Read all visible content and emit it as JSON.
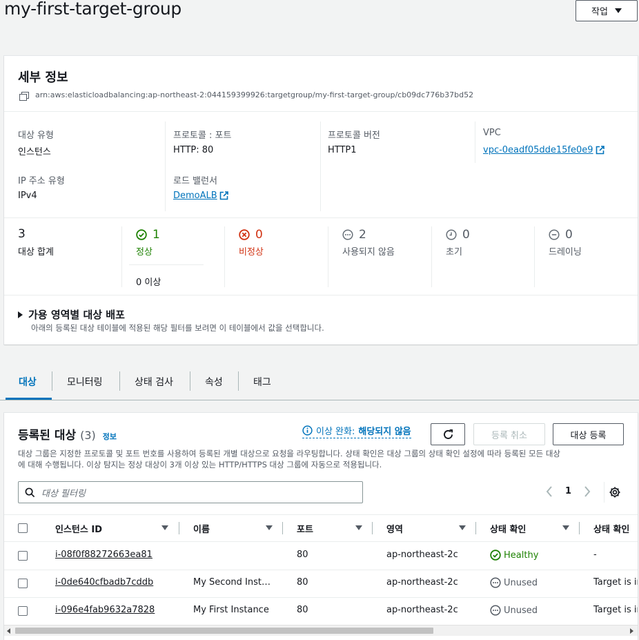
{
  "header": {
    "title": "my-first-target-group",
    "actions_label": "작업"
  },
  "details": {
    "heading": "세부 정보",
    "arn": "arn:aws:elasticloadbalancing:ap-northeast-2:044159399926:targetgroup/my-first-target-group/cb09dc776b37bd52",
    "target_type_label": "대상 유형",
    "target_type_value": "인스턴스",
    "protocol_port_label": "프로토콜 : 포트",
    "protocol_port_value": "HTTP: 80",
    "protocol_version_label": "프로토콜 버전",
    "protocol_version_value": "HTTP1",
    "vpc_label": "VPC",
    "vpc_value": "vpc-0eadf05dde15fe0e9",
    "ip_type_label": "IP 주소 유형",
    "ip_type_value": "IPv4",
    "lb_label": "로드 밸런서",
    "lb_value": "DemoALB"
  },
  "stats": {
    "total_value": "3",
    "total_label": "대상 합계",
    "healthy_value": "1",
    "healthy_label": "정상",
    "healthy_sub": "0 이상",
    "unhealthy_value": "0",
    "unhealthy_label": "비정상",
    "unused_value": "2",
    "unused_label": "사용되지 않음",
    "initial_value": "0",
    "initial_label": "초기",
    "draining_value": "0",
    "draining_label": "드레이닝"
  },
  "az": {
    "title": "가용 영역별 대상 배포",
    "desc": "아래의 등록된 대상 테이블에 적용된 해당 필터를 보려면 이 테이블에서 값을 선택합니다."
  },
  "tabs": [
    "대상",
    "모니터링",
    "상태 검사",
    "속성",
    "태그"
  ],
  "targets": {
    "title": "등록된 대상",
    "count": "(3)",
    "info": "정보",
    "anomaly_label": "이상 완화:",
    "anomaly_value": "해당되지 않음",
    "deregister_label": "등록 취소",
    "register_label": "대상 등록",
    "desc_line1": "대상 그룹은 지정한 프로토콜 및 포트 번호를 사용하여 등록된 개별 대상으로 요청을 라우팅합니다. 상태 확인은 대상 그룹의 상태 확인 설정에 따라 등록된 모든 대상",
    "desc_line2": "에 대해 수행됩니다. 이상 탐지는 정상 대상이 3개 이상 있는 HTTP/HTTPS 대상 그룹에 자동으로 적용됩니다.",
    "filter_placeholder": "대상 필터링",
    "page": "1",
    "columns": [
      "인스턴스 ID",
      "이름",
      "포트",
      "영역",
      "상태 확인",
      "상태 확인"
    ],
    "rows": [
      {
        "id": "i-08f0f88272663ea81",
        "name": "",
        "port": "80",
        "zone": "ap-northeast-2c",
        "health": "Healthy",
        "details": "-"
      },
      {
        "id": "i-0de640cfbadb7cddb",
        "name": "My Second Inst…",
        "port": "80",
        "zone": "ap-northeast-2c",
        "health": "Unused",
        "details": "Target is in"
      },
      {
        "id": "i-096e4fab9632a7828",
        "name": "My First Instance",
        "port": "80",
        "zone": "ap-northeast-2c",
        "health": "Unused",
        "details": "Target is in"
      }
    ]
  },
  "colors": {
    "link": "#0073bb",
    "healthy": "#1d8102",
    "unhealthy": "#d13212",
    "muted": "#687078"
  }
}
